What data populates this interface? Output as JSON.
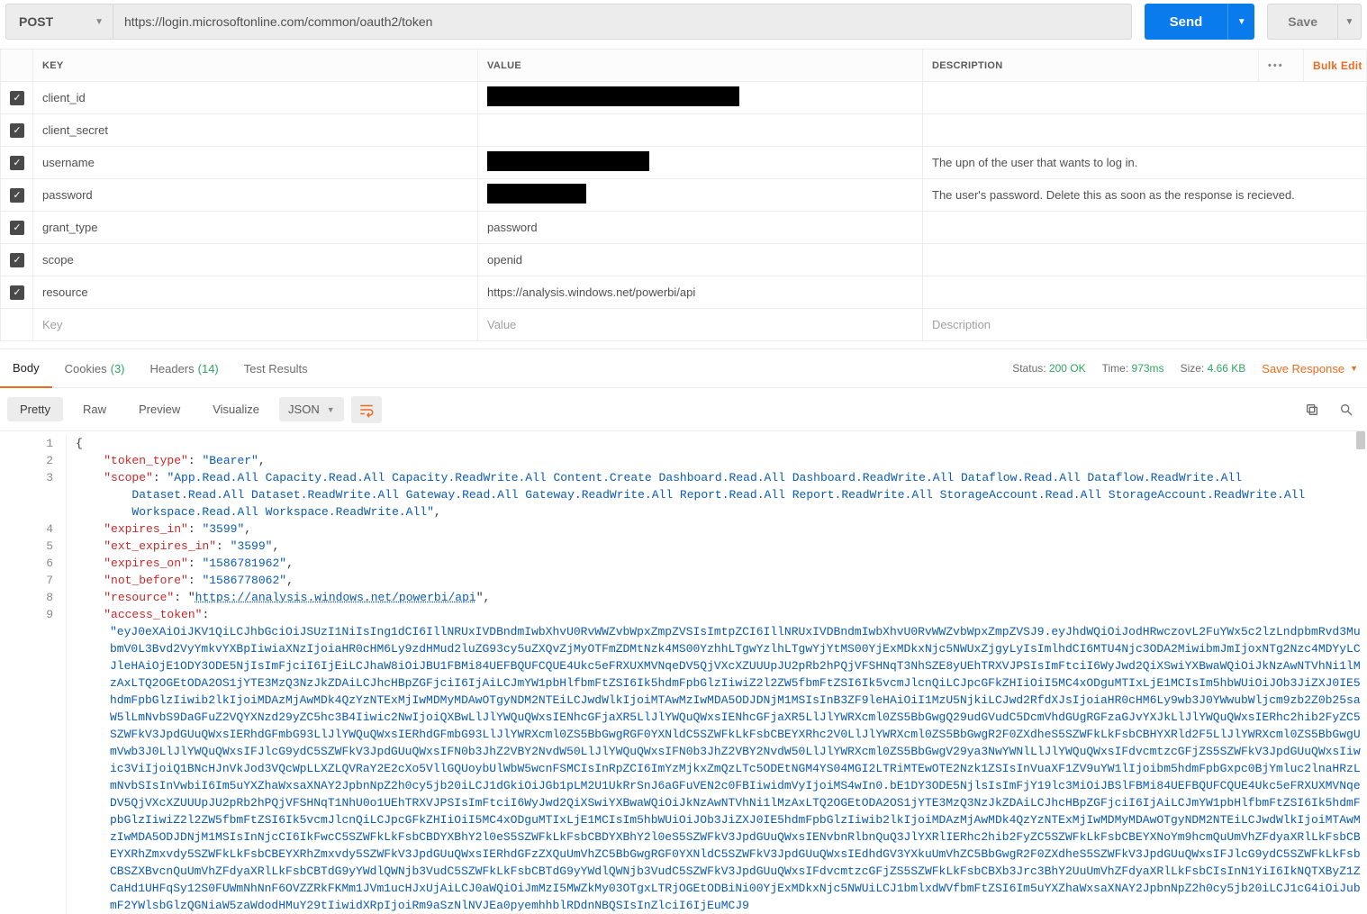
{
  "request": {
    "method": "POST",
    "url": "https://login.microsoftonline.com/common/oauth2/token",
    "send_label": "Send",
    "save_label": "Save"
  },
  "params_header": {
    "key": "KEY",
    "value": "VALUE",
    "description": "DESCRIPTION"
  },
  "bulk_edit_label": "Bulk Edit",
  "params": [
    {
      "key": "client_id",
      "value": "",
      "description": "",
      "redact": "big"
    },
    {
      "key": "client_secret",
      "value": "",
      "description": "",
      "redact": null
    },
    {
      "key": "username",
      "value": "",
      "description": "The upn of the user that wants to log in.",
      "redact": "med"
    },
    {
      "key": "password",
      "value": "",
      "description": "The user's password.  Delete this as soon as the response is recieved.",
      "redact": "sm"
    },
    {
      "key": "grant_type",
      "value": "password",
      "description": "",
      "redact": null
    },
    {
      "key": "scope",
      "value": "openid",
      "description": "",
      "redact": null
    },
    {
      "key": "resource",
      "value": "https://analysis.windows.net/powerbi/api",
      "description": "",
      "redact": null
    }
  ],
  "params_placeholder": {
    "key": "Key",
    "value": "Value",
    "description": "Description"
  },
  "response_tabs": {
    "body": "Body",
    "cookies": "Cookies",
    "cookies_count": "(3)",
    "headers": "Headers",
    "headers_count": "(14)",
    "tests": "Test Results"
  },
  "response_meta": {
    "status_label": "Status:",
    "status_value": "200 OK",
    "time_label": "Time:",
    "time_value": "973ms",
    "size_label": "Size:",
    "size_value": "4.66 KB",
    "save_response": "Save Response"
  },
  "response_toolbar": {
    "pretty": "Pretty",
    "raw": "Raw",
    "preview": "Preview",
    "visualize": "Visualize",
    "format": "JSON"
  },
  "response_body": {
    "token_type": "Bearer",
    "scope": "App.Read.All Capacity.Read.All Capacity.ReadWrite.All Content.Create Dashboard.Read.All Dashboard.ReadWrite.All Dataflow.Read.All Dataflow.ReadWrite.All Dataset.Read.All Dataset.ReadWrite.All Gateway.Read.All Gateway.ReadWrite.All Report.Read.All Report.ReadWrite.All StorageAccount.Read.All StorageAccount.ReadWrite.All Workspace.Read.All Workspace.ReadWrite.All",
    "expires_in": "3599",
    "ext_expires_in": "3599",
    "expires_on": "1586781962",
    "not_before": "1586778062",
    "resource": "https://analysis.windows.net/powerbi/api",
    "access_token": "eyJ0eXAiOiJKV1QiLCJhbGciOiJSUzI1NiIsIng1dCI6IllNRUxIVDBndmIwbXhvU0RvWWZvbWpxZmpZVSIsImtpZCI6IllNRUxIVDBndmIwbXhvU0RvWWZvbWpxZmpZVSJ9.eyJhdWQiOiJodHRwczovL2FuYWx5c2lzLndpbmRvd3MubmV0L3Bvd2VyYmkvYXBpIiwiaXNzIjoiaHR0cHM6Ly9zdHMud2luZG93cy5uZXQvZjMyOTFmZDMtNzk4MS00YzhhLTgwYzlhLTgwYjYtMS00YjExMDkxNjc5NWUxZjgyLyIsImlhdCI6MTU4Njc3ODA2MiwibmJmIjoxNTg2Nzc4MDYyLCJleHAiOjE1ODY3ODE5NjIsImFjciI6IjEiLCJhaW8iOiJBU1FBMi84UEFBQUFCQUE4Ukc5eFRXUXMVNqeDV5QjVXcXZUUUpJU2pRb2hPQjVFSHNqT3NhSZE8yUEhTRXVJPSIsImFtciI6WyJwd2QiXSwiYXBwaWQiOiJkNzAwNTVhNi1lMzAxLTQ2OGEtODA2OS1jYTE3MzQ3NzJkZDAiLCJhcHBpZGFjciI6IjAiLCJmYW1pbHlfbmFtZSI6Ik5hdmFpbGlzIiwiZ2l2ZW5fbmFtZSI6Ik5vcmJlcnQiLCJpcGFkZHIiOiI5MC4xODguMTIxLjE1MCIsIm5hbWUiOiJOb3JiZXJ0IE5hdmFpbGlzIiwib2lkIjoiMDAzMjAwMDk4QzYzNTExMjIwMDMyMDAwOTgyNDM2NTEiLCJwdWlkIjoiMTAwMzIwMDA5ODJDNjM1MSIsInB3ZF9leHAiOiI1MzU5NjkiLCJwd2RfdXJsIjoiaHR0cHM6Ly9wb3J0YWwubWljcm9zb2Z0b25saW5lLmNvbS9DaGFuZ2VQYXNzd29yZC5hc3B4Iiwic2NwIjoiQXBwLlJlYWQuQWxsIENhcGFjaXR5LlJlYWQuQWxsIENhcGFjaXR5LlJlYWRXcml0ZS5BbGwgQ29udGVudC5DcmVhdGUgRGFzaGJvYXJkLlJlYWQuQWxsIERhc2hib2FyZC5SZWFkV3JpdGUuQWxsIERhdGFmbG93LlJlYWQuQWxsIERhdGFmbG93LlJlYWRXcml0ZS5BbGwgRGF0YXNldC5SZWFkLkFsbCBEYXRhc2V0LlJlYWRXcml0ZS5BbGwgR2F0ZXdheS5SZWFkLkFsbCBHYXRld2F5LlJlYWRXcml0ZS5BbGwgUmVwb3J0LlJlYWQuQWxsIFJlcG9ydC5SZWFkV3JpdGUuQWxsIFN0b3JhZ2VBY2NvdW50LlJlYWQuQWxsIFN0b3JhZ2VBY2NvdW50LlJlYWRXcml0ZS5BbGwgV29ya3NwYWNlLlJlYWQuQWxsIFdvcmtzcGFjZS5SZWFkV3JpdGUuQWxsIiwic3ViIjoiQ1BNcHJnVkJod3VQcWpLLXZLQVRaY2E2cXo5VllGQUoybUlWbW5wcnFSMCIsInRpZCI6ImYzMjkxZmQzLTc5ODEtNGM4YS04MGI2LTRiMTEwOTE2Nzk1ZSIsInVuaXF1ZV9uYW1lIjoibm5hdmFpbGxpc0BjYmluc2lnaHRzLmNvbSIsInVwbiI6Im5uYXZhaWxsaXNAY2JpbnNpZ2h0cy5jb20iLCJ1dGkiOiJGb1pLM2U1UkRrSnJ6aGFuVEN2c0FBIiwidmVyIjoiMS4wIn0.bE1DY3ODE5NjlsIsImFjY19lc3MiOiJBSlFBMi84UEFBQUFCQUE4Ukc5eFRXUXMVNqeDV5QjVXcXZUUUpJU2pRb2hPQjVFSHNqT1NhU0o1UEhTRXVJPSIsImFtciI6WyJwd2QiXSwiYXBwaWQiOiJkNzAwNTVhNi1lMzAxLTQ2OGEtODA2OS1jYTE3MzQ3NzJkZDAiLCJhcHBpZGFjciI6IjAiLCJmYW1pbHlfbmFtZSI6Ik5hdmFpbGlzIiwiZ2l2ZW5fbmFtZSI6Ik5vcmJlcnQiLCJpcGFkZHIiOiI5MC4xODguMTIxLjE1MCIsIm5hbWUiOiJOb3JiZXJ0IE5hdmFpbGlzIiwib2lkIjoiMDAzMjAwMDk4QzYzNTExMjIwMDMyMDAwOTgyNDM2NTEiLCJwdWlkIjoiMTAwMzIwMDA5ODJDNjM1MSIsInNjcCI6IkFwcC5SZWFkLkFsbCBDYXBhY2l0eS5SZWFkLkFsbCBDYXBhY2l0eS5SZWFkV3JpdGUuQWxsIENvbnRlbnQuQ3JlYXRlIERhc2hib2FyZC5SZWFkLkFsbCBEYXNoYm9hcmQuUmVhZFdyaXRlLkFsbCBEYXRhZmxvdy5SZWFkLkFsbCBEYXRhZmxvdy5SZWFkV3JpdGUuQWxsIERhdGFzZXQuUmVhZC5BbGwgRGF0YXNldC5SZWFkV3JpdGUuQWxsIEdhdGV3YXkuUmVhZC5BbGwgR2F0ZXdheS5SZWFkV3JpdGUuQWxsIFJlcG9ydC5SZWFkLkFsbCBSZXBvcnQuUmVhZFdyaXRlLkFsbCBTdG9yYWdlQWNjb3VudC5SZWFkLkFsbCBTdG9yYWdlQWNjb3VudC5SZWFkV3JpdGUuQWxsIFdvcmtzcGFjZS5SZWFkLkFsbCBXb3Jrc3BhY2UuUmVhZFdyaXRlLkFsbCIsInN1YiI6IkNQTXByZ1ZCaHd1UHFqSy12S0FUWmNhNnF6OVZZRkFKMm1JVm1ucHJxUjAiLCJ0aWQiOiJmMzI5MWZkMy03OTgxLTRjOGEtODBiNi00YjExMDkxNjc5NWUiLCJ1bmlxdWVfbmFtZSI6Im5uYXZhaWxsaXNAY2JpbnNpZ2h0cy5jb20iLCJ1cG4iOiJubmF2YWlsbGlzQGNiaW5zaWdodHMuY29tIiwidXRpIjoiRm9aSzNlNVJEa0pyemhhblRDdnNBQSIsInZlciI6IjEuMCJ9"
  },
  "line_numbers": [
    "1",
    "2",
    "3",
    "",
    "",
    "4",
    "5",
    "6",
    "7",
    "8",
    "9"
  ]
}
